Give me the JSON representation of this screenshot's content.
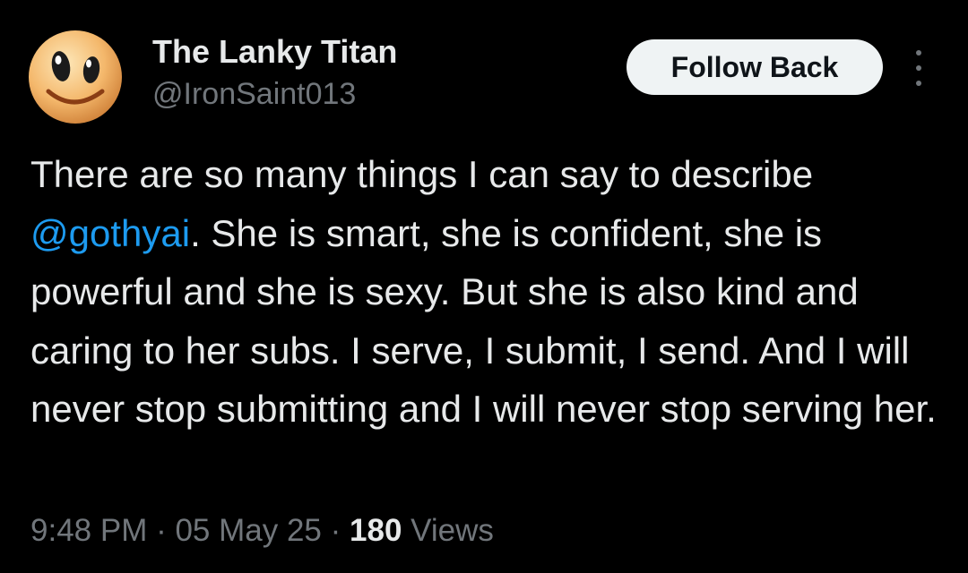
{
  "author": {
    "display_name": "The Lanky Titan",
    "handle": "@IronSaint013",
    "avatar_icon": "cartoon-face-avatar"
  },
  "actions": {
    "follow_label": "Follow Back",
    "more_icon": "vertical-dots-icon"
  },
  "tweet": {
    "text_before_mention": "There are so many things I can say to describe ",
    "mention": "@gothyai",
    "text_after_mention": ". She is smart, she is confident, she is powerful and she is sexy. But she is also kind and caring to her subs. I serve, I submit, I send. And I will never stop submitting and I will never stop serving her."
  },
  "meta": {
    "time": "9:48 PM",
    "separator": " · ",
    "date": "05 May 25",
    "views_count": "180",
    "views_label": "Views"
  },
  "colors": {
    "background": "#000000",
    "text_primary": "#e7e9ea",
    "text_secondary": "#71767b",
    "link": "#1d9bf0",
    "button_bg": "#eff3f4",
    "button_text": "#0f1419"
  }
}
